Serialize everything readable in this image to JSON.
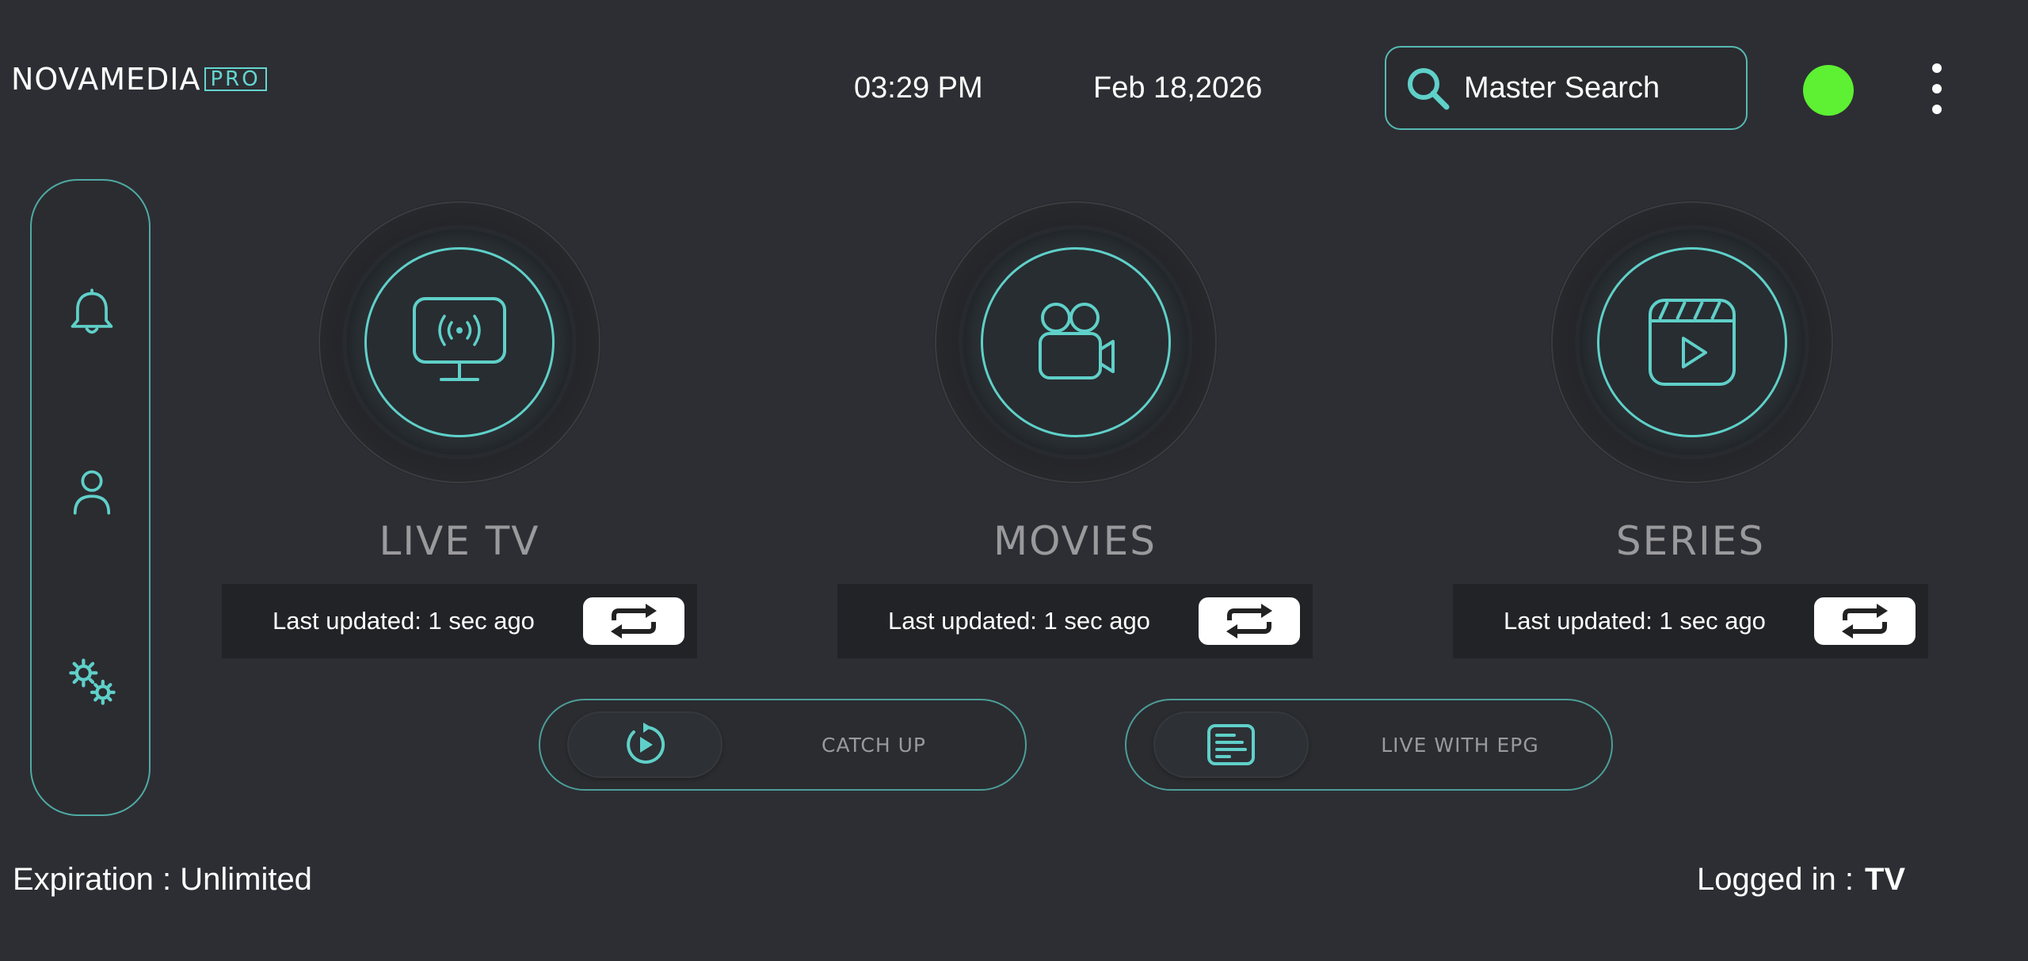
{
  "header": {
    "brand": "NOVAMEDIA",
    "brand_badge": "PRO",
    "time": "03:29 PM",
    "date": "Feb 18,2026",
    "search_label": "Master Search",
    "status_color": "#5df033"
  },
  "sidebar": {
    "items": [
      {
        "name": "notifications",
        "icon": "bell-icon"
      },
      {
        "name": "profile",
        "icon": "user-icon"
      },
      {
        "name": "settings",
        "icon": "gears-icon"
      }
    ]
  },
  "categories": [
    {
      "title": "LIVE TV",
      "icon": "tv-broadcast-icon",
      "updated": "Last updated: 1 sec ago"
    },
    {
      "title": "MOVIES",
      "icon": "movie-camera-icon",
      "updated": "Last updated: 1 sec ago"
    },
    {
      "title": "SERIES",
      "icon": "clapperboard-icon",
      "updated": "Last updated: 1 sec ago"
    }
  ],
  "actions": [
    {
      "label": "CATCH UP",
      "icon": "replay-icon"
    },
    {
      "label": "LIVE WITH EPG",
      "icon": "guide-icon"
    }
  ],
  "footer": {
    "expiration": "Expiration : Unlimited",
    "logged_in_label": "Logged in :",
    "logged_in_user": "TV"
  },
  "colors": {
    "accent": "#5fd0c9",
    "background": "#2d2e33",
    "status": "#5df033"
  }
}
